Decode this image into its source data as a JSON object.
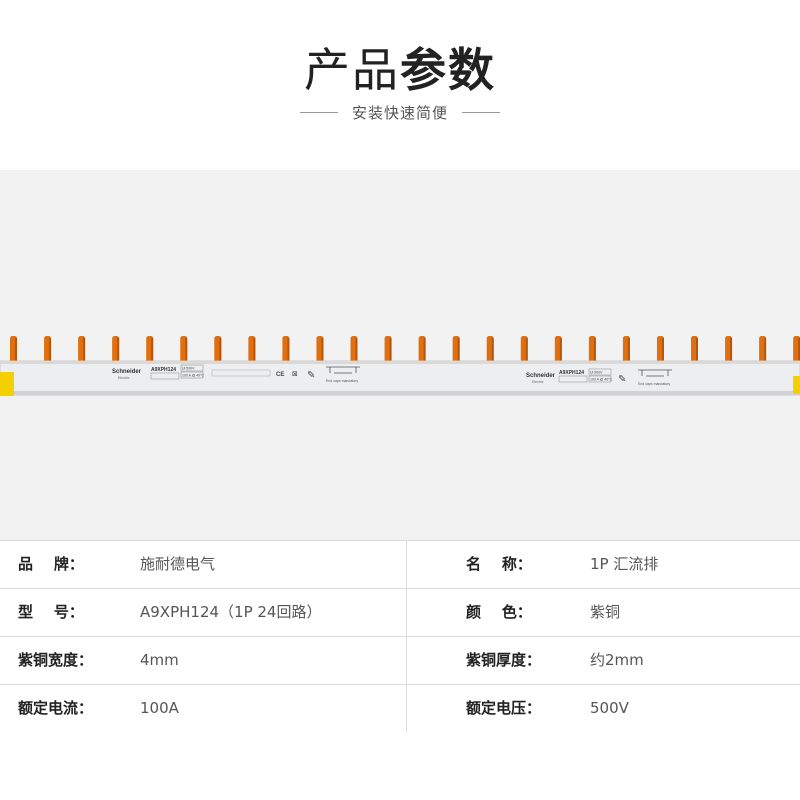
{
  "header": {
    "title_part1": "产品",
    "title_part2": "参数",
    "subtitle": "安装快速简便"
  },
  "product": {
    "brand_mark": "Schneider",
    "brand_sub": "Electric",
    "model_code": "A9XPH124",
    "rating_1": "Ui 500V",
    "rating_2": "100 A @ 40°C",
    "endcap_text": "End caps mandatory",
    "tooth_count": 24,
    "colors": {
      "copper": "#e0700f",
      "copper_dark": "#b8550a",
      "bar": "#e9e9ec",
      "endcap": "#f5d000"
    }
  },
  "specs": {
    "rows": [
      {
        "left_label": "品    牌：",
        "left_value": "施耐德电气",
        "right_label": "名    称：",
        "right_value": "1P 汇流排"
      },
      {
        "left_label": "型    号：",
        "left_value": "A9XPH124（1P 24回路）",
        "right_label": "颜    色：",
        "right_value": "紫铜"
      },
      {
        "left_label": "紫铜宽度：",
        "left_value": "4mm",
        "right_label": "紫铜厚度：",
        "right_value": "约2mm"
      },
      {
        "left_label": "额定电流：",
        "left_value": "100A",
        "right_label": "额定电压：",
        "right_value": "500V"
      }
    ]
  }
}
